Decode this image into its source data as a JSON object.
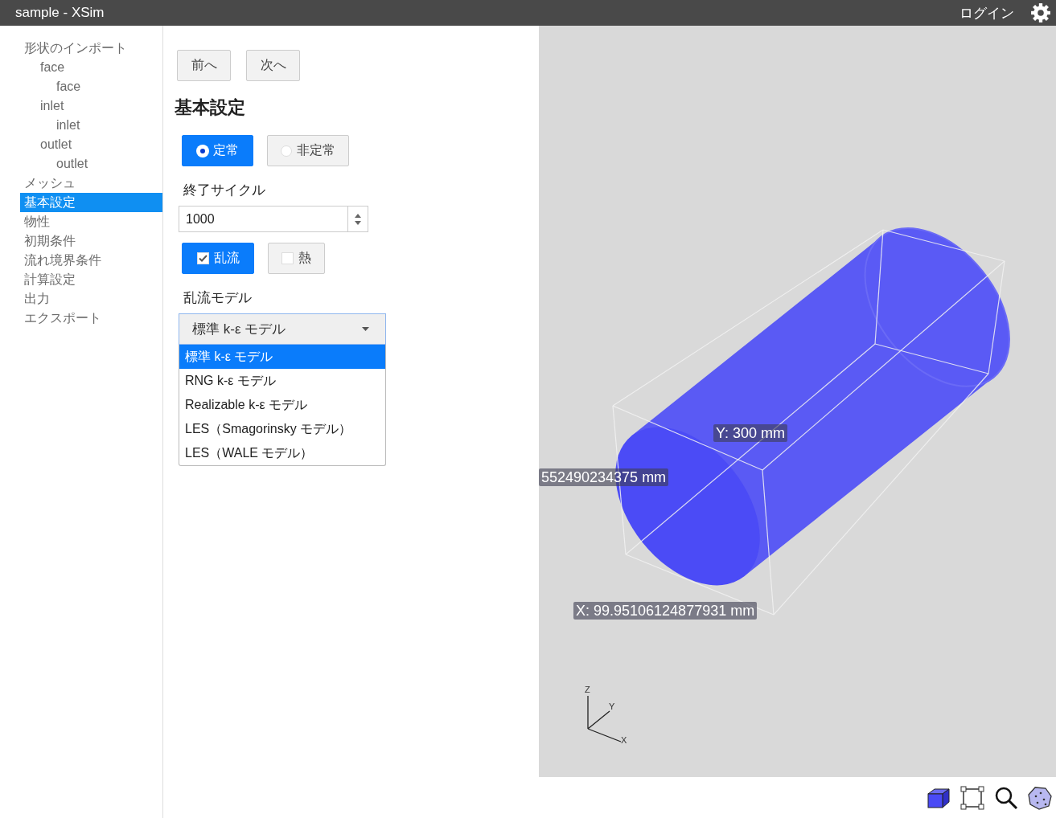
{
  "window": {
    "title": "sample - XSim"
  },
  "header": {
    "login": "ログイン"
  },
  "sidebar": {
    "items": [
      {
        "label": "形状のインポート",
        "selected": false,
        "children": [
          {
            "label": "face",
            "selected": false,
            "children": [
              {
                "label": "face",
                "selected": false
              }
            ]
          },
          {
            "label": "inlet",
            "selected": false,
            "children": [
              {
                "label": "inlet",
                "selected": false
              }
            ]
          },
          {
            "label": "outlet",
            "selected": false,
            "children": [
              {
                "label": "outlet",
                "selected": false
              }
            ]
          }
        ]
      },
      {
        "label": "メッシュ",
        "selected": false
      },
      {
        "label": "基本設定",
        "selected": true
      },
      {
        "label": "物性",
        "selected": false
      },
      {
        "label": "初期条件",
        "selected": false
      },
      {
        "label": "流れ境界条件",
        "selected": false
      },
      {
        "label": "計算設定",
        "selected": false
      },
      {
        "label": "出力",
        "selected": false
      },
      {
        "label": "エクスポート",
        "selected": false
      }
    ]
  },
  "nav_buttons": [
    "前へ",
    "次へ"
  ],
  "section_title": "基本設定",
  "mode_options": [
    {
      "label": "定常",
      "selected": true
    },
    {
      "label": "非定常",
      "selected": false
    }
  ],
  "end_cycle": {
    "label": "終了サイクル",
    "value": "1000"
  },
  "physics_toggles": [
    {
      "label": "乱流",
      "checked": true
    },
    {
      "label": "熱",
      "checked": false
    }
  ],
  "turbulence_model": {
    "label": "乱流モデル",
    "value": "標準 k-ε モデル",
    "expanded": true,
    "options": [
      {
        "label": "標準 k-ε モデル",
        "selected": true
      },
      {
        "label": "RNG k-ε モデル",
        "selected": false
      },
      {
        "label": "Realizable k-ε モデル",
        "selected": false
      },
      {
        "label": "LES（Smagorinsky モデル）",
        "selected": false
      },
      {
        "label": "LES（WALE モデル）",
        "selected": false
      }
    ]
  },
  "viewer": {
    "dimension_labels": [
      "Y: 300 mm",
      "552490234375 mm",
      "X: 99.95106124877931 mm"
    ],
    "axes": [
      "Z",
      "Y",
      "X"
    ]
  }
}
